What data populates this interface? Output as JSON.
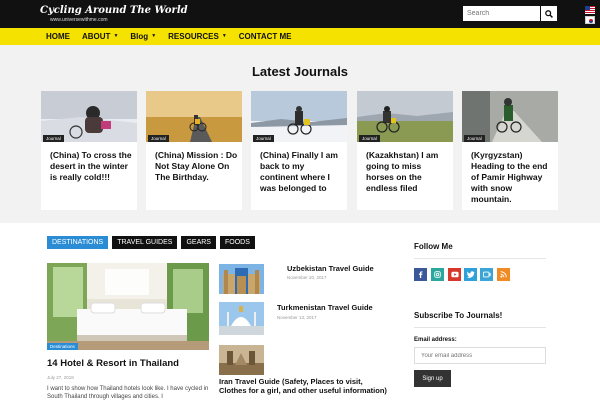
{
  "header": {
    "logo_title": "Cycling Around The World",
    "logo_subtitle": "www.universewithme.com",
    "search_placeholder": "Search"
  },
  "nav": {
    "items": [
      {
        "label": "HOME",
        "dropdown": false
      },
      {
        "label": "ABOUT",
        "dropdown": true
      },
      {
        "label": "Blog",
        "dropdown": true
      },
      {
        "label": "RESOURCES",
        "dropdown": true
      },
      {
        "label": "CONTACT ME",
        "dropdown": false
      }
    ]
  },
  "latest": {
    "heading": "Latest Journals",
    "cards": [
      {
        "tag": "Journal",
        "title": "(China) To cross the desert in the winter is really cold!!!"
      },
      {
        "tag": "Journal",
        "title": "(China) Mission : Do Not Stay Alone On The Birthday."
      },
      {
        "tag": "Journal",
        "title": "(China) Finally I am back to my continent where I was belonged to"
      },
      {
        "tag": "Journal",
        "title": "(Kazakhstan) I am going to miss horses on the endless filed"
      },
      {
        "tag": "Journal",
        "title": "(Kyrgyzstan) Heading to the end of Pamir Highway with snow mountain."
      }
    ]
  },
  "tabs": [
    "DESTINATIONS",
    "TRAVEL GUIDES",
    "GEARS",
    "FOODS"
  ],
  "feature": {
    "tag": "Destinations",
    "title": "14 Hotel & Resort in Thailand",
    "date": "July 27, 2018",
    "excerpt": "I want to show how Thailand hotels look like. I have cycled in South Thailand through villages and cities. I"
  },
  "posts": [
    {
      "title": "Uzbekistan Travel Guide",
      "date": "November 20, 2017"
    },
    {
      "title": "Turkmenistan Travel Guide",
      "date": "November 13, 2017"
    },
    {
      "title": "Iran Travel Guide (Safety, Places to visit, Clothes for a girl, and other useful information)",
      "date": ""
    }
  ],
  "sidebar": {
    "follow_heading": "Follow Me",
    "subscribe_heading": "Subscribe To Journals!",
    "email_label": "Email address:",
    "email_placeholder": "Your email address",
    "signup_label": "Sign up"
  },
  "colors": {
    "nav_yellow": "#f5e200",
    "accent_blue": "#2b8cd6",
    "facebook": "#3b5998",
    "instagram": "#2ca7a0",
    "youtube": "#d6382c",
    "twitter": "#2fa0d8",
    "vimeo": "#3ba6d6",
    "rss": "#f08a24"
  }
}
